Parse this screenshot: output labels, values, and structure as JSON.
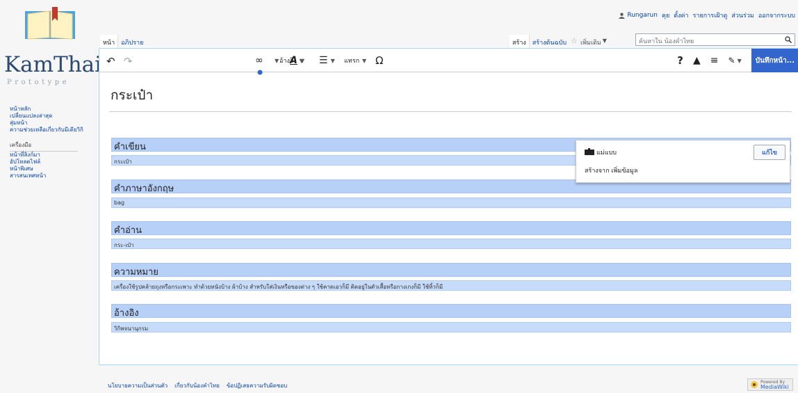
{
  "logo": {
    "text": "KamThai",
    "subtitle": "Prototype"
  },
  "personal": {
    "user": "Rungarun",
    "items": [
      "คุย",
      "ตั้งค่า",
      "รายการเฝ้าดู",
      "ส่วนร่วม",
      "ออกจากระบบ"
    ]
  },
  "tabs": {
    "page": "หน้า",
    "discussion": "อภิปราย",
    "create": "สร้าง",
    "create_source": "สร้างต้นฉบับ",
    "more": "เพิ่มเติม"
  },
  "search": {
    "placeholder": "ค้นหาใน น้องคำไทย"
  },
  "toolbar": {
    "cite": "อ้างอิง",
    "insert": "แทรก",
    "save": "บันทึกหน้า..."
  },
  "page": {
    "title": "กระเป๋า"
  },
  "sections": [
    {
      "heading": "คำเขียน",
      "body": "กระเป๋า"
    },
    {
      "heading": "คำภาษาอังกฤษ",
      "body": "bag"
    },
    {
      "heading": "คำอ่าน",
      "body": "กระ-เป๋า"
    },
    {
      "heading": "ความหมาย",
      "body": "เครื่องใช้รูปคล้ายถุงหรือกระเพาะ ทำด้วยหนังบ้าง ผ้าบ้าง สำหรับใส่เงินหรือของต่าง ๆ ใช้คาดเอวก็มี ติดอยู่ในตัวเสื้อหรือกางเกงก็มี ใช้หิ้วก็มี"
    },
    {
      "heading": "อ้างอิง",
      "body": "วิกิพจนานุกรม"
    }
  ],
  "popup": {
    "title": "แม่แบบ",
    "edit": "แก้ไข",
    "note": "สร้างจาก เพิ่มข้อมูล"
  },
  "sidebar": {
    "nav": [
      "หน้าหลัก",
      "เปลี่ยนแปลงล่าสุด",
      "สุ่มหน้า",
      "ความช่วยเหลือเกี่ยวกับมีเดียวิกิ"
    ],
    "tools_heading": "เครื่องมือ",
    "tools": [
      "หน้าที่ลิงก์มา",
      "อัปโหลดไฟล์",
      "หน้าพิเศษ",
      "สารสนเทศหน้า"
    ]
  },
  "footer": {
    "links": [
      "นโยบายความเป็นส่วนตัว",
      "เกี่ยวกับน้องคำไทย",
      "ข้อปฏิเสธความรับผิดชอบ"
    ]
  },
  "badge": {
    "top": "Powered By",
    "name": "MediaWiki"
  }
}
